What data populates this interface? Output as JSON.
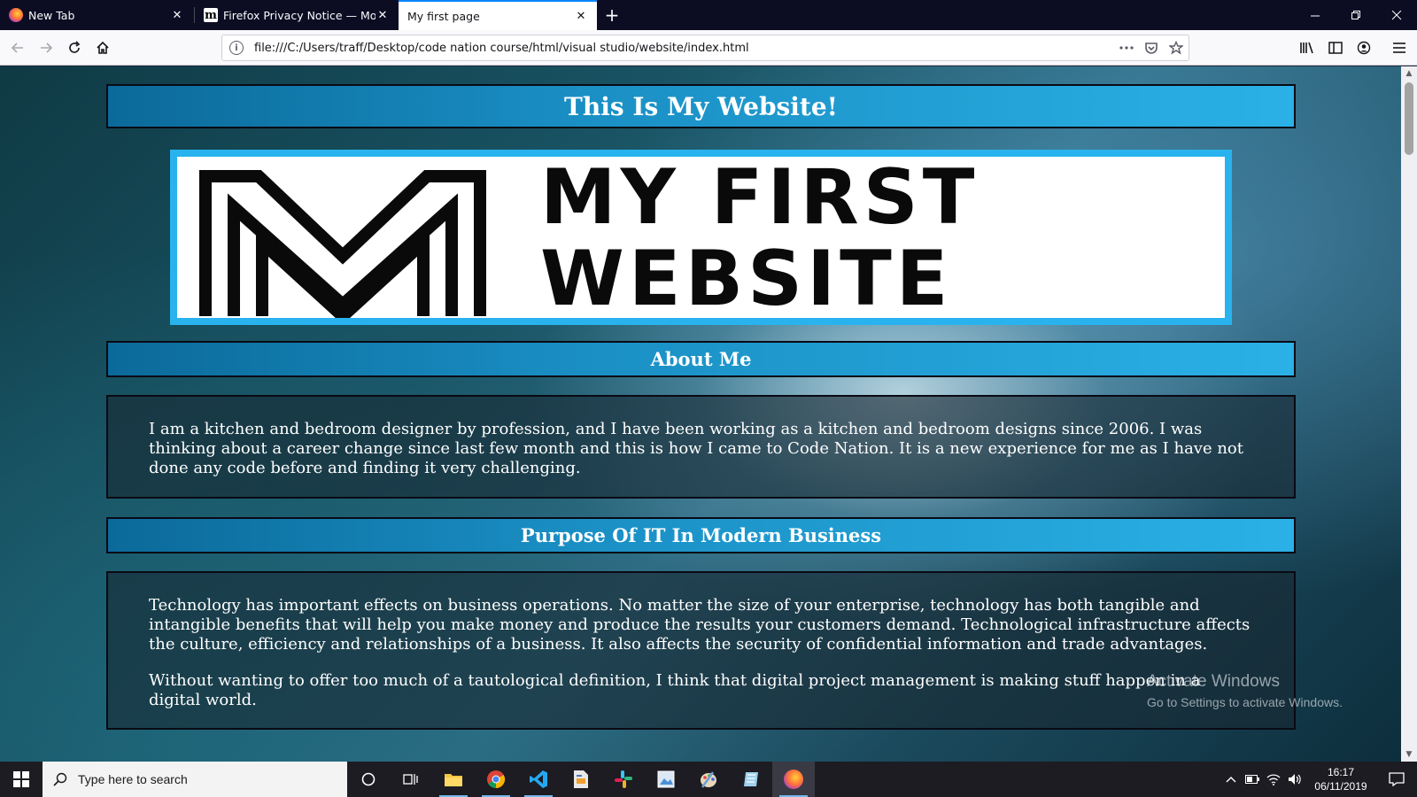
{
  "browser": {
    "tabs": [
      {
        "title": "New Tab",
        "favicon": "firefox-icon"
      },
      {
        "title": "Firefox Privacy Notice — Mozilla",
        "favicon": "mozilla-m-icon"
      },
      {
        "title": "My first page",
        "favicon": "none",
        "active": true
      }
    ],
    "url": "file:///C:/Users/traff/Desktop/code nation course/html/visual studio/website/index.html",
    "accent_color": "#0a84ff"
  },
  "page": {
    "header_title": "This Is My Website!",
    "banner_line1": "MY FIRST",
    "banner_line2": "WEBSITE",
    "about_heading": "About Me",
    "about_text": "I am a kitchen and bedroom designer by profession, and I have been working as a kitchen and bedroom designs since 2006. I was thinking about a career change since last few month and this is how I came to Code Nation. It is a new experience for me as I have not done any code before and finding it very challenging.",
    "purpose_heading": "Purpose Of IT In Modern Business",
    "purpose_p1": "Technology has important effects on business operations. No matter the size of your enterprise, technology has both tangible and intangible benefits that will help you make money and produce the results your customers demand. Technological infrastructure affects the culture, efficiency and relationships of a business. It also affects the security of confidential information and trade advantages.",
    "purpose_p2": "Without wanting to offer too much of a tautological definition, I think that digital project management is making stuff happen in a digital world.",
    "heading_bar_color": "#1a8fc4"
  },
  "watermark": {
    "title": "Activate Windows",
    "subtitle": "Go to Settings to activate Windows."
  },
  "taskbar": {
    "search_placeholder": "Type here to search",
    "time": "16:17",
    "date": "06/11/2019"
  }
}
